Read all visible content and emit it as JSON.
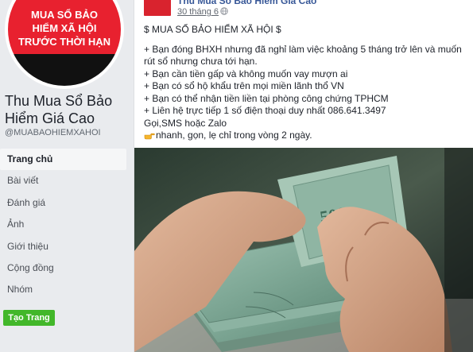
{
  "sidebar": {
    "avatar_text": [
      "MUA SỔ BẢO",
      "HIỂM XÃ HỘI",
      "TRƯỚC THỜI HẠN"
    ],
    "page_name": "Thu Mua Sổ Bảo Hiểm Giá Cao",
    "page_handle": "@MUABAOHIEMXAHOI",
    "nav_items": [
      {
        "label": "Trang chủ",
        "active": true
      },
      {
        "label": "Bài viết"
      },
      {
        "label": "Đánh giá"
      },
      {
        "label": "Ảnh"
      },
      {
        "label": "Giới thiệu"
      },
      {
        "label": "Cộng đồng"
      },
      {
        "label": "Nhóm"
      }
    ],
    "create_page_label": "Tạo Trang"
  },
  "post": {
    "author": "Thu Mua Sổ Bảo Hiểm Giá Cao",
    "date": "30 tháng 6",
    "privacy_icon": "globe-icon",
    "lines": [
      "$ MUA SỔ BẢO HIỂM XÃ HỘI $",
      "+ Bạn đóng BHXH nhưng đã nghỉ làm việc khoảng 5 tháng trở lên và muốn",
      "rút sổ nhưng chưa tới hạn.",
      "+ Bạn cần tiền gấp và không muốn vay mượn ai",
      "+ Bạn có sổ hộ khẩu trên mọi miền lãnh thổ VN",
      "+ Bạn có thể nhận tiền liền tại phòng công chứng TPHCM",
      "+ Liên hệ trực tiếp 1 số điện thoại duy nhất 086.641.3497",
      "Gọi,SMS hoặc Zalo",
      "nhanh, gọn, lẹ chỉ trong vòng 2 ngày."
    ],
    "emoji_icon": "pointing-hand-icon",
    "photo_description_icon": "money-counting-photo"
  },
  "colors": {
    "brand_red": "#e8212f",
    "link_blue": "#385898",
    "button_green": "#42b72a"
  }
}
